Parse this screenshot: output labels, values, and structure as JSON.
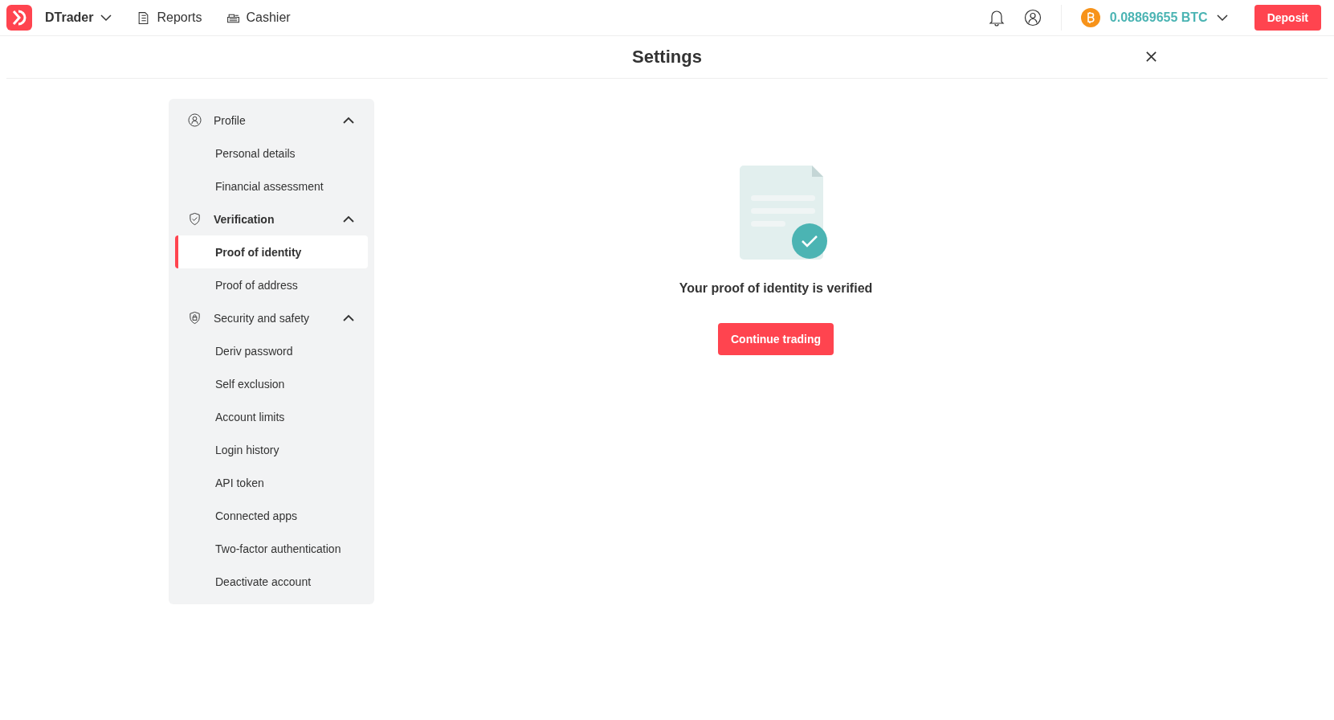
{
  "header": {
    "app_name": "DTrader",
    "nav": [
      {
        "label": "Reports"
      },
      {
        "label": "Cashier"
      }
    ],
    "balance": "0.08869655 BTC",
    "deposit": "Deposit"
  },
  "page": {
    "title": "Settings"
  },
  "sidebar": {
    "groups": [
      {
        "label": "Profile",
        "expanded": true,
        "active": false,
        "items": [
          {
            "label": "Personal details",
            "selected": false
          },
          {
            "label": "Financial assessment",
            "selected": false
          }
        ]
      },
      {
        "label": "Verification",
        "expanded": true,
        "active": true,
        "items": [
          {
            "label": "Proof of identity",
            "selected": true
          },
          {
            "label": "Proof of address",
            "selected": false
          }
        ]
      },
      {
        "label": "Security and safety",
        "expanded": true,
        "active": false,
        "items": [
          {
            "label": "Deriv password",
            "selected": false
          },
          {
            "label": "Self exclusion",
            "selected": false
          },
          {
            "label": "Account limits",
            "selected": false
          },
          {
            "label": "Login history",
            "selected": false
          },
          {
            "label": "API token",
            "selected": false
          },
          {
            "label": "Connected apps",
            "selected": false
          },
          {
            "label": "Two-factor authentication",
            "selected": false
          },
          {
            "label": "Deactivate account",
            "selected": false
          }
        ]
      }
    ]
  },
  "content": {
    "message": "Your proof of identity is verified",
    "button": "Continue trading"
  }
}
